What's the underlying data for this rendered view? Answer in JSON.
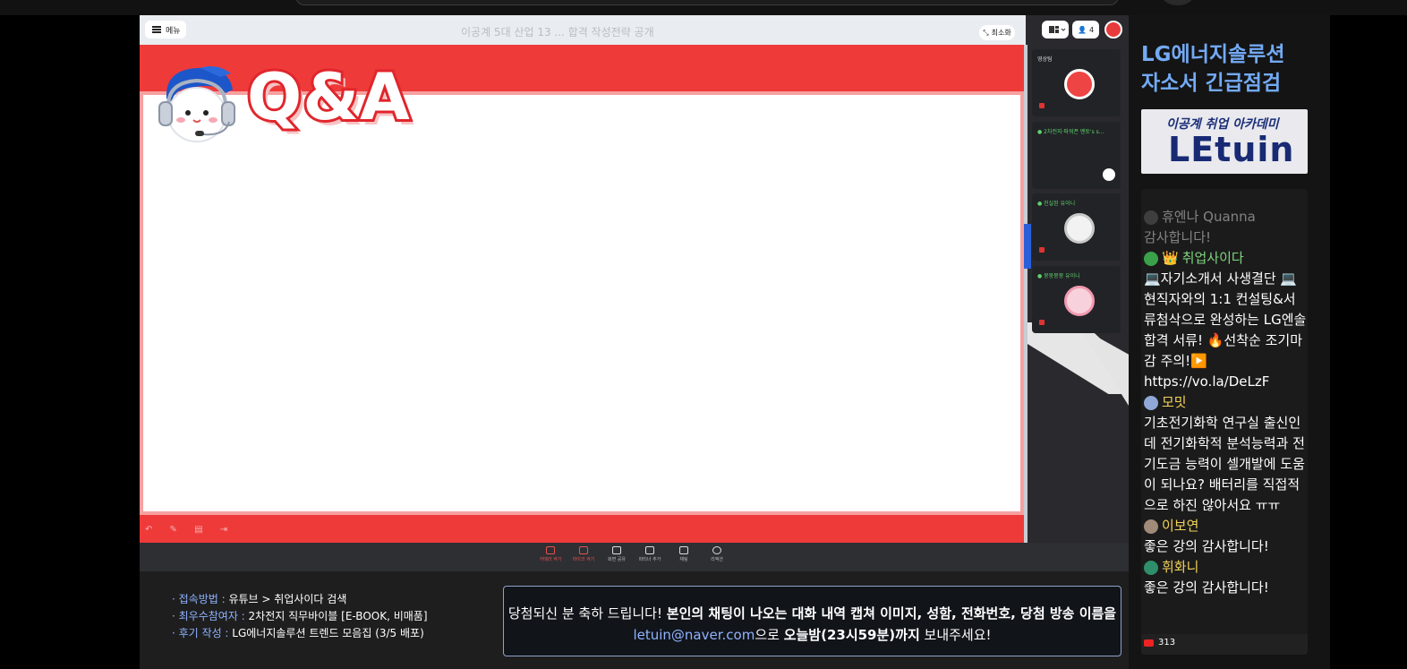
{
  "meeting": {
    "menu_label": "메뉴",
    "ghost_title": "이공계 5대 산업 13 ...                        합격 작성전략 공개",
    "minimize_label": "최소화",
    "participant_count": "4",
    "slide_title": "Q&A",
    "slide_tools": "↶ ✎ ▤ ⇥",
    "participants": [
      {
        "label": "영상팀",
        "label_color": "white"
      },
      {
        "label": "● 2차전지·파워픈 멘토's s...",
        "label_color": "green"
      },
      {
        "label": "● 진실된 유이니",
        "label_color": "green"
      },
      {
        "label": "● 뭉뭉뭉뭉 유이니",
        "label_color": "green"
      }
    ],
    "toolbar": {
      "camera": "카메라 켜기",
      "mic": "마이크 켜기",
      "share": "화면 공유",
      "invite": "파티너 추가",
      "chat": "채팅",
      "reaction": "리액션"
    }
  },
  "banner": {
    "info": [
      {
        "key": "· 접속방법 :",
        "value": " 유튜브 > 취업사이다 검색"
      },
      {
        "key": "· 최우수참여자 :",
        "value": " 2차전지 직무바이블 [E-BOOK, 비매품]"
      },
      {
        "key": "· 후기 작성 :",
        "value": " LG에너지솔루션 트렌드 모음집 (3/5 배포)"
      }
    ],
    "notice_part1": "당첨되신 분 축하 드립니다! ",
    "notice_part2": "본인의 채팅이 나오는 대화 내역 캡쳐 이미지, 성함, 전화번호, 당첨 방송 이름을",
    "notice_mail": "letuin@naver.com",
    "notice_part3": "으로 ",
    "notice_part4": "오늘밤(23시59분)까지",
    "notice_part5": " 보내주세요!"
  },
  "sidebar": {
    "title_line1": "LG에너지솔루션",
    "title_line2": "자소서 긴급점검",
    "logo_small": "이공계 취업 아카데미",
    "logo_big": "LEtuin",
    "chat": [
      {
        "name": "휴엔나 Quanna",
        "text": "감사합니다!",
        "faded": true,
        "avatar": "#6b6b6b"
      },
      {
        "name": "취업사이다",
        "text": "💻자기소개서 사생결단 💻현직자와의 1:1 컨설팅&서류첨삭으로 완성하는 LG엔솔 합격 서류! 🔥선착순 조기마감 주의!▶️ https://vo.la/DeLzF",
        "faded": false,
        "avatar": "#3aa14a",
        "crown": "👑",
        "name_color": "#7fd47f"
      },
      {
        "name": "모밋",
        "text": "기초전기화학 연구실 출신인데 전기화학적 분석능력과 전기도금 능력이 셀개발에 도움이 되나요? 배터리를 직접적으로 하진 않아서요 ㅠㅠ",
        "faded": false,
        "avatar": "#8fa8d8",
        "name_color": "#f2d25a"
      },
      {
        "name": "이보연",
        "text": "좋은 강의 감사합니다!",
        "faded": false,
        "avatar": "#a08a78",
        "name_color": "#f2d25a"
      },
      {
        "name": "휘화니",
        "text": "좋은 강의 감사합니다!",
        "faded": false,
        "avatar": "#2e8f6a",
        "name_color": "#f2d25a"
      }
    ],
    "viewers": "313"
  },
  "colors": {
    "slide_red": "#ef3a3a",
    "accent_blue": "#73aaf4",
    "chat_green": "#5fd36d"
  }
}
